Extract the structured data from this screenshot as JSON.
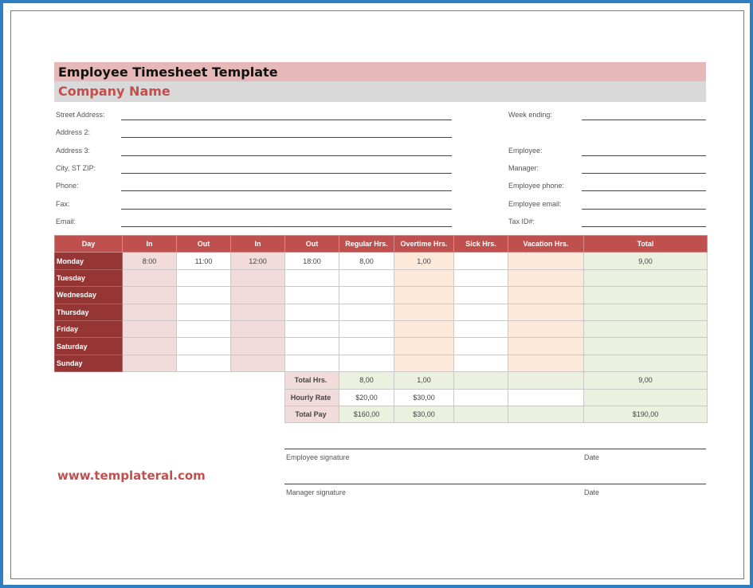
{
  "document": {
    "title": "Employee Timesheet Template",
    "company_name": "Company Name",
    "website": "www.templateral.com"
  },
  "fields_left": [
    "Street Address:",
    "Address 2:",
    "Address 3:",
    "City, ST ZIP:",
    "Phone:",
    "Fax:",
    "Email:"
  ],
  "fields_right": {
    "week_ending": "Week ending:",
    "employee": "Employee:",
    "manager": "Manager:",
    "employee_phone": "Employee phone:",
    "employee_email": "Employee email:",
    "tax_id": "Tax ID#:"
  },
  "table": {
    "headers": [
      "Day",
      "In",
      "Out",
      "In",
      "Out",
      "Regular Hrs.",
      "Overtime Hrs.",
      "Sick Hrs.",
      "Vacation Hrs.",
      "Total"
    ],
    "rows": [
      {
        "day": "Monday",
        "in1": "8:00",
        "out1": "11:00",
        "in2": "12:00",
        "out2": "18:00",
        "regular": "8,00",
        "overtime": "1,00",
        "sick": "",
        "vacation": "",
        "total": "9,00"
      },
      {
        "day": "Tuesday",
        "in1": "",
        "out1": "",
        "in2": "",
        "out2": "",
        "regular": "",
        "overtime": "",
        "sick": "",
        "vacation": "",
        "total": ""
      },
      {
        "day": "Wednesday",
        "in1": "",
        "out1": "",
        "in2": "",
        "out2": "",
        "regular": "",
        "overtime": "",
        "sick": "",
        "vacation": "",
        "total": ""
      },
      {
        "day": "Thursday",
        "in1": "",
        "out1": "",
        "in2": "",
        "out2": "",
        "regular": "",
        "overtime": "",
        "sick": "",
        "vacation": "",
        "total": ""
      },
      {
        "day": "Friday",
        "in1": "",
        "out1": "",
        "in2": "",
        "out2": "",
        "regular": "",
        "overtime": "",
        "sick": "",
        "vacation": "",
        "total": ""
      },
      {
        "day": "Saturday",
        "in1": "",
        "out1": "",
        "in2": "",
        "out2": "",
        "regular": "",
        "overtime": "",
        "sick": "",
        "vacation": "",
        "total": ""
      },
      {
        "day": "Sunday",
        "in1": "",
        "out1": "",
        "in2": "",
        "out2": "",
        "regular": "",
        "overtime": "",
        "sick": "",
        "vacation": "",
        "total": ""
      }
    ],
    "summary": {
      "total_hrs": {
        "label": "Total Hrs.",
        "regular": "8,00",
        "overtime": "1,00",
        "sick": "",
        "vacation": "",
        "total": "9,00"
      },
      "hourly_rate": {
        "label": "Hourly Rate",
        "regular": "$20,00",
        "overtime": "$30,00",
        "sick": "",
        "vacation": "",
        "total": ""
      },
      "total_pay": {
        "label": "Total Pay",
        "regular": "$160,00",
        "overtime": "$30,00",
        "sick": "",
        "vacation": "",
        "total": "$190,00"
      }
    }
  },
  "signatures": {
    "employee_label": "Employee signature",
    "manager_label": "Manager signature",
    "date_label": "Date"
  },
  "colors": {
    "header_red": "#c0504d",
    "day_dark_red": "#963634",
    "title_pink": "#e6b8b7",
    "company_gray": "#d9d9d9",
    "frame_blue": "#2f7fc1"
  }
}
